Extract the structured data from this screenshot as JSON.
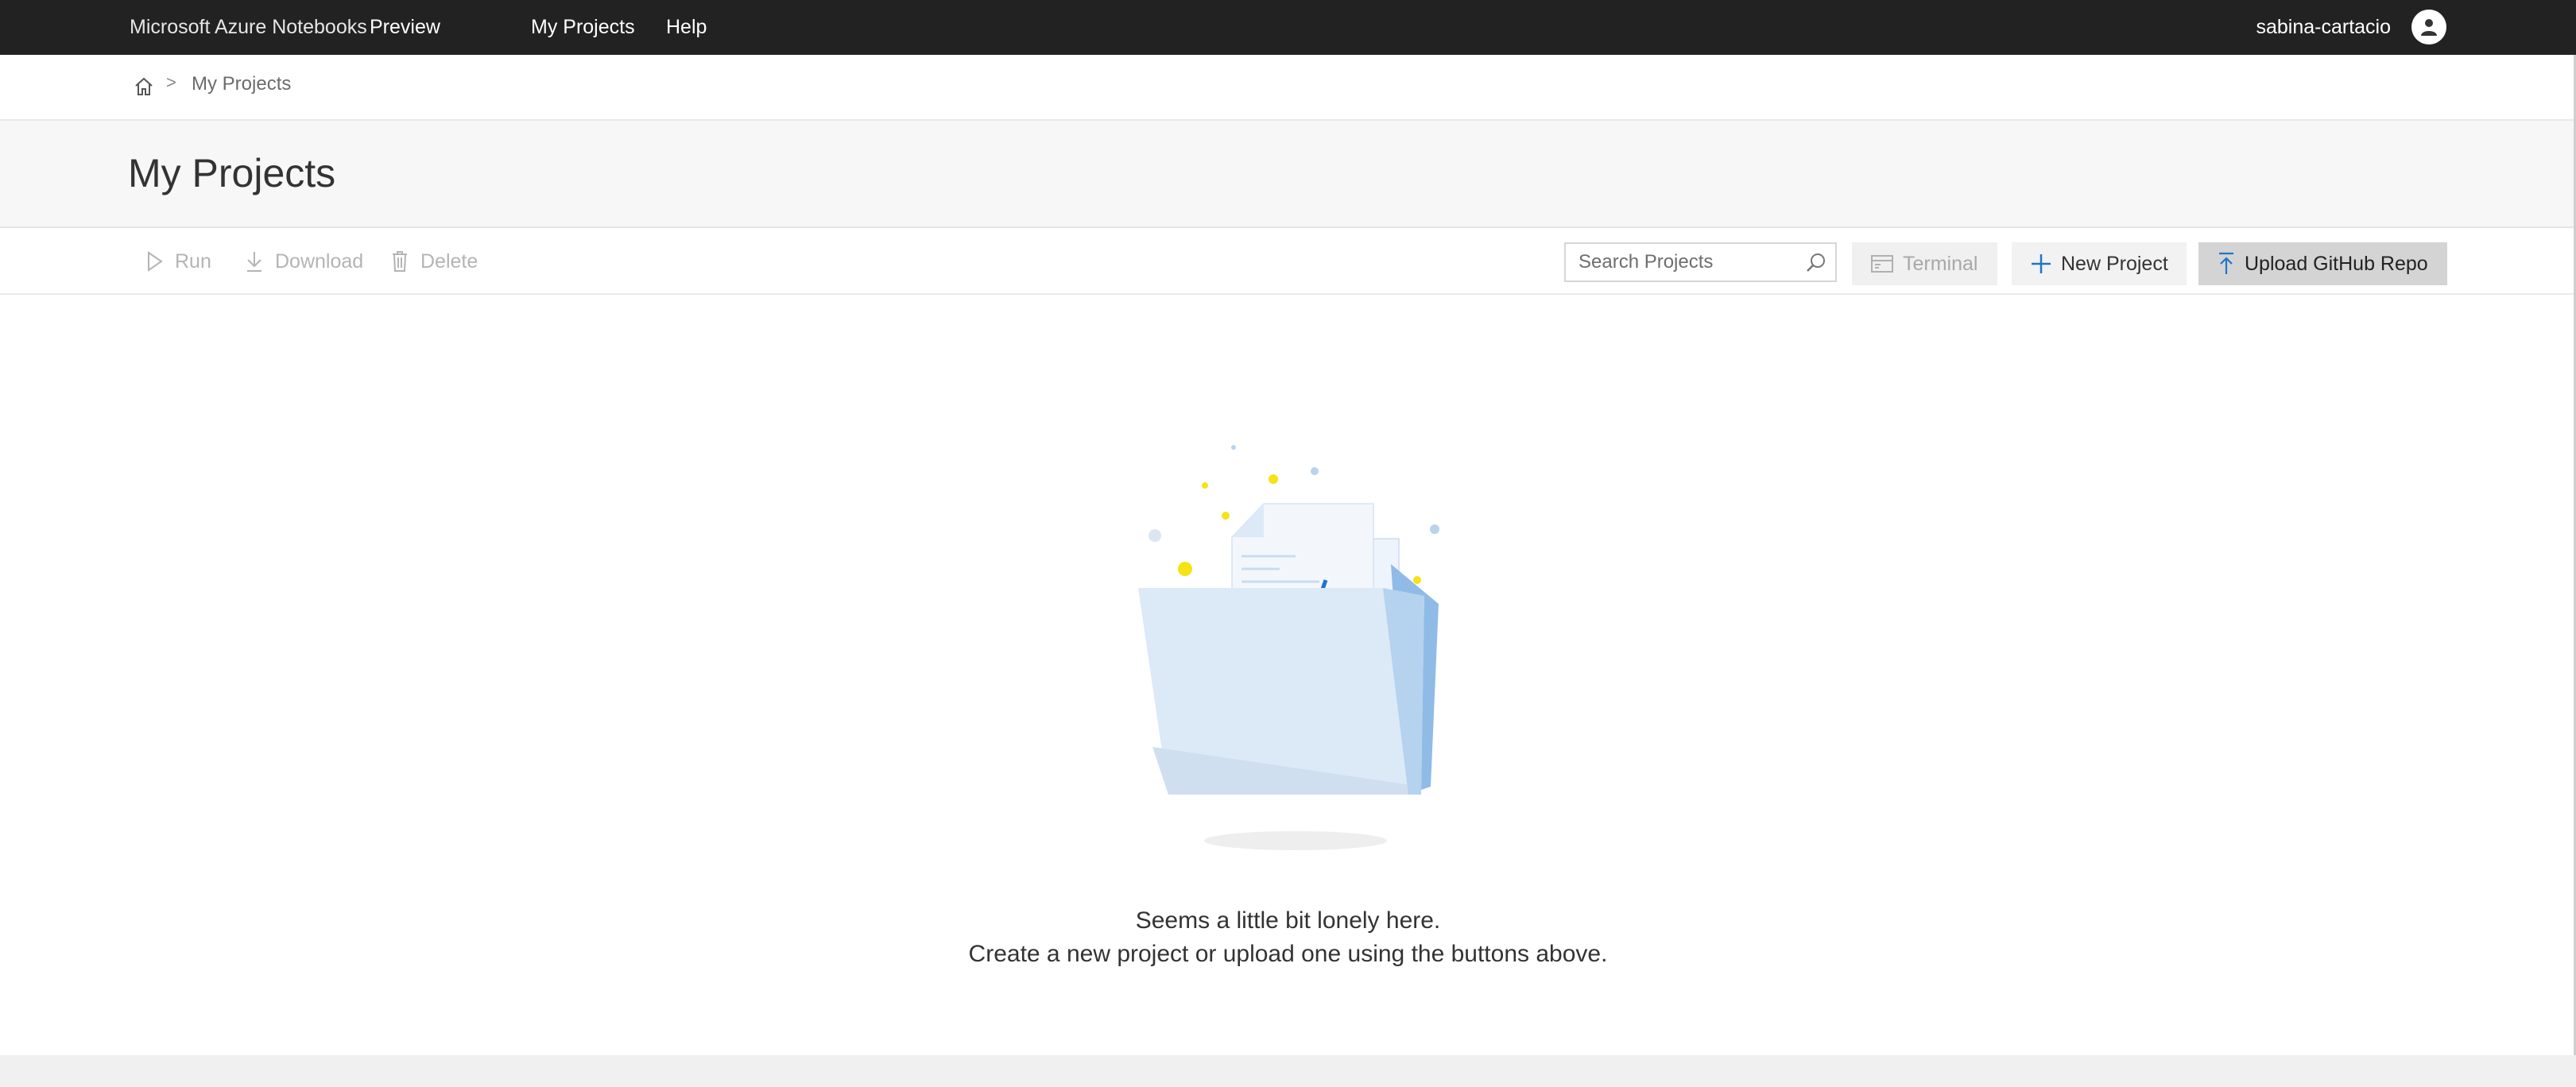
{
  "topnav": {
    "brand": "Microsoft Azure Notebooks",
    "preview": "Preview",
    "links": [
      {
        "label": "My Projects"
      },
      {
        "label": "Help"
      }
    ],
    "user_name": "sabina-cartacio"
  },
  "breadcrumb": {
    "separator": ">",
    "current": "My Projects"
  },
  "page": {
    "title": "My Projects"
  },
  "toolbar": {
    "run_label": "Run",
    "download_label": "Download",
    "delete_label": "Delete",
    "search_placeholder": "Search Projects",
    "terminal_label": "Terminal",
    "new_project_label": "New Project",
    "upload_label": "Upload GitHub Repo"
  },
  "empty_state": {
    "line1": "Seems a little bit lonely here.",
    "line2": "Create a new project or upload one using the buttons above."
  },
  "colors": {
    "nav_bg": "#222222",
    "accent_blue": "#1f76c9",
    "folder_light": "#dce9f7",
    "sparkle_yellow": "#f5e313"
  }
}
